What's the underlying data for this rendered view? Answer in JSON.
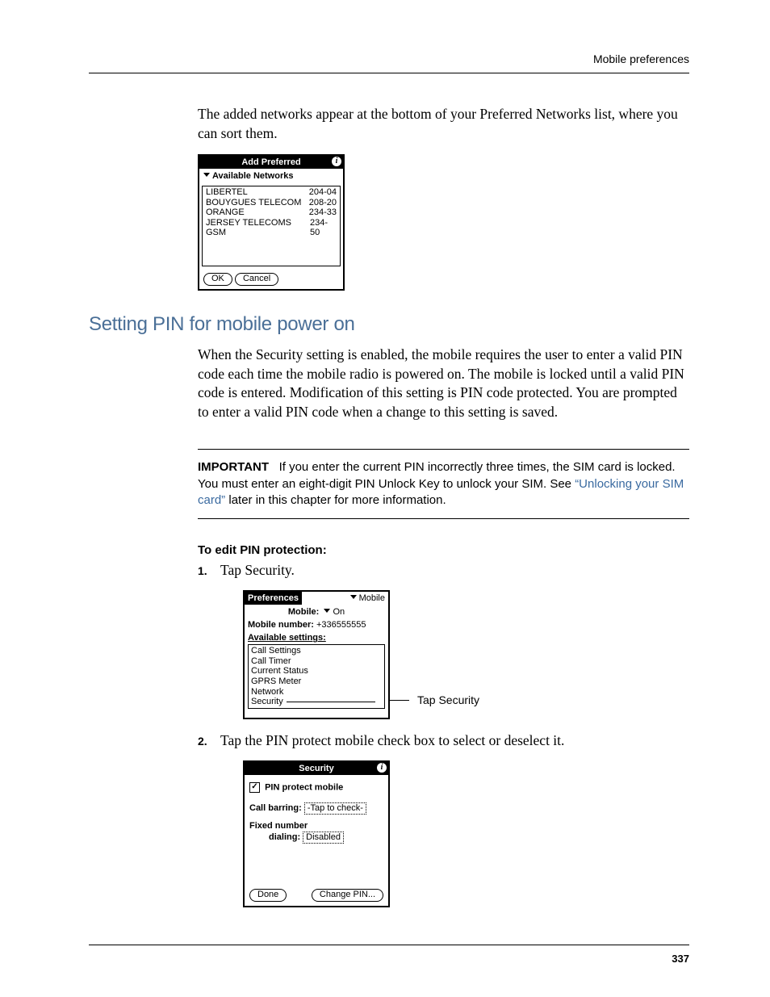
{
  "header": {
    "running_head": "Mobile preferences"
  },
  "intro": "The added networks appear at the bottom of your Preferred Networks list, where you can sort them.",
  "screen1": {
    "title": "Add Preferred",
    "dropdown_label": "Available Networks",
    "networks": [
      {
        "name": "LIBERTEL",
        "code": "204-04"
      },
      {
        "name": "BOUYGUES TELECOM",
        "code": "208-20"
      },
      {
        "name": "ORANGE",
        "code": "234-33"
      },
      {
        "name": "JERSEY TELECOMS GSM",
        "code": "234-50"
      }
    ],
    "ok": "OK",
    "cancel": "Cancel"
  },
  "section_heading": "Setting PIN for mobile power on",
  "section_body": "When the Security setting is enabled, the mobile requires the user to enter a valid PIN code each time the mobile radio is powered on. The mobile is locked until a valid PIN code is entered. Modification of this setting is PIN code protected. You are prompted to enter a valid PIN code when a change to this setting is saved.",
  "important": {
    "label": "IMPORTANT",
    "text_before_link": "If you enter the current PIN incorrectly three times, the SIM card is locked. You must enter an eight-digit PIN Unlock Key to unlock your SIM. See ",
    "link": "“Unlocking your SIM card”",
    "text_after_link": " later in this chapter for more information."
  },
  "edit_heading": "To edit PIN protection:",
  "steps": {
    "s1": "Tap Security.",
    "s2": "Tap the PIN protect mobile check box to select or deselect it."
  },
  "screen2": {
    "title_left": "Preferences",
    "title_right": "Mobile",
    "mobile_label": "Mobile:",
    "mobile_value": "On",
    "number_label": "Mobile number:",
    "number_value": "+336555555",
    "avail_label": "Available settings:",
    "items": [
      "Call Settings",
      "Call Timer",
      "Current Status",
      "GPRS Meter",
      "Network",
      "Security"
    ],
    "callout": "Tap Security"
  },
  "screen3": {
    "title": "Security",
    "pin_protect": "PIN protect mobile",
    "call_barring_label": "Call barring:",
    "call_barring_value": "-Tap to check-",
    "fixed_label1": "Fixed number",
    "fixed_label2": "dialing:",
    "fixed_value": "Disabled",
    "done": "Done",
    "change_pin": "Change PIN..."
  },
  "page_number": "337"
}
